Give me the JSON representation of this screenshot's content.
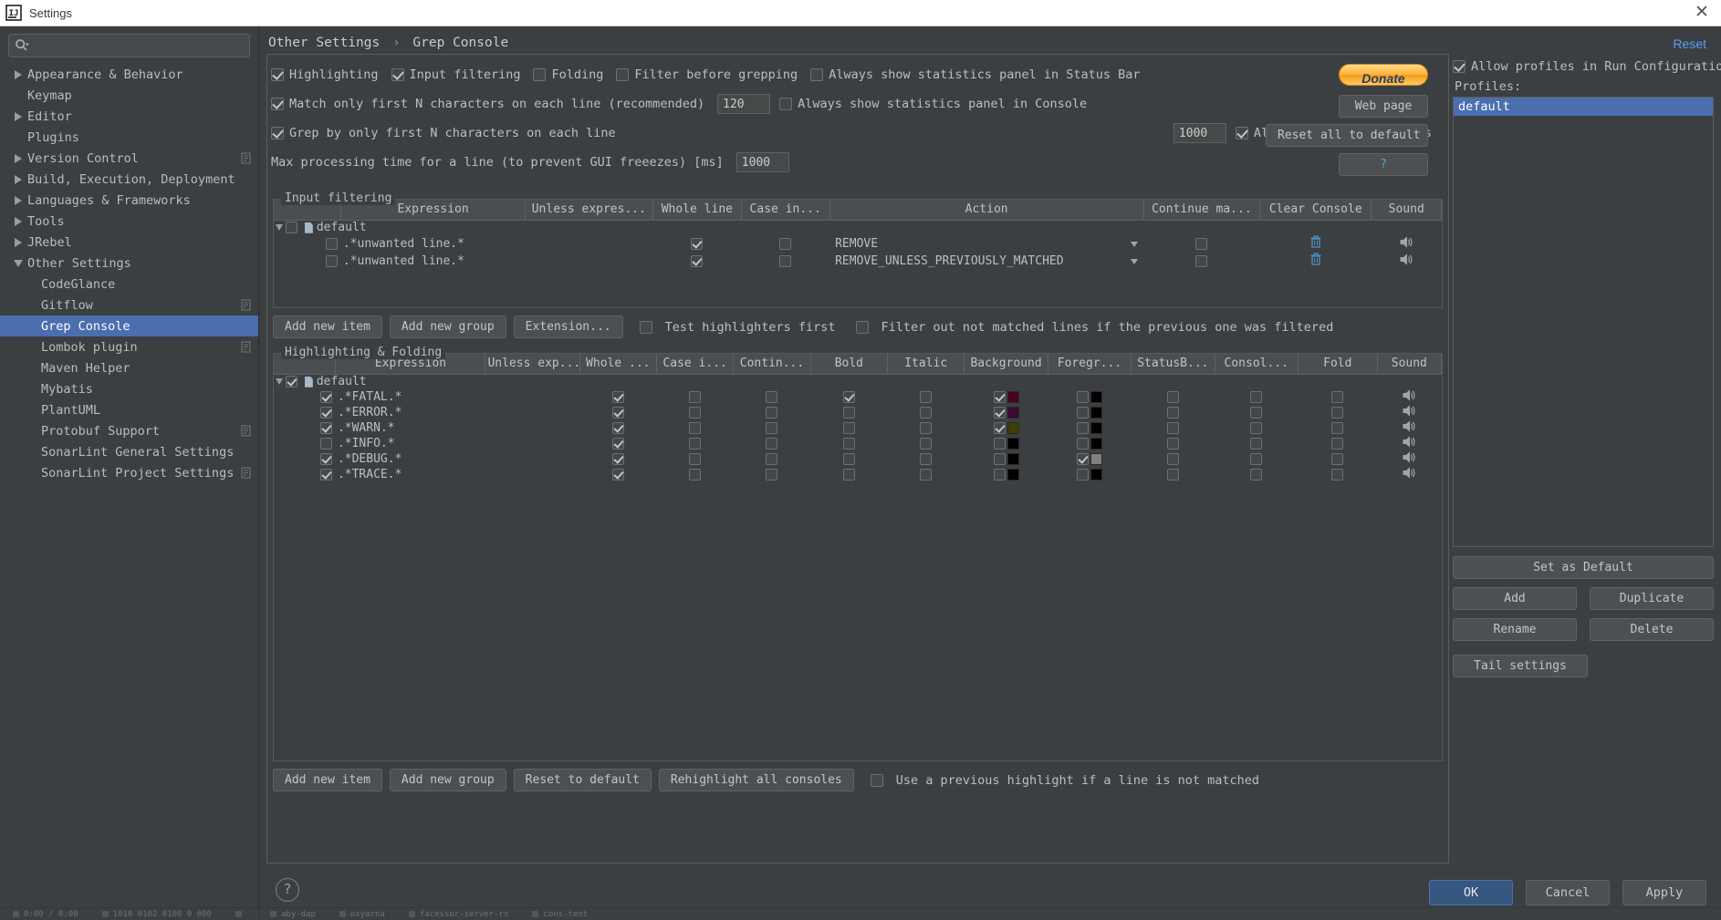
{
  "window": {
    "title": "Settings",
    "close_label": "✕",
    "logo": "intellij-idea-logo"
  },
  "sidebar": {
    "search_placeholder": "",
    "items": [
      {
        "label": "Appearance & Behavior",
        "level": 1,
        "twisty": "collapsed",
        "selected": false,
        "badge": false
      },
      {
        "label": "Keymap",
        "level": 1,
        "twisty": "none",
        "selected": false,
        "badge": false
      },
      {
        "label": "Editor",
        "level": 1,
        "twisty": "collapsed",
        "selected": false,
        "badge": false
      },
      {
        "label": "Plugins",
        "level": 1,
        "twisty": "none",
        "selected": false,
        "badge": false
      },
      {
        "label": "Version Control",
        "level": 1,
        "twisty": "collapsed",
        "selected": false,
        "badge": true
      },
      {
        "label": "Build, Execution, Deployment",
        "level": 1,
        "twisty": "collapsed",
        "selected": false,
        "badge": false
      },
      {
        "label": "Languages & Frameworks",
        "level": 1,
        "twisty": "collapsed",
        "selected": false,
        "badge": false
      },
      {
        "label": "Tools",
        "level": 1,
        "twisty": "collapsed",
        "selected": false,
        "badge": false
      },
      {
        "label": "JRebel",
        "level": 1,
        "twisty": "collapsed",
        "selected": false,
        "badge": false
      },
      {
        "label": "Other Settings",
        "level": 1,
        "twisty": "expanded",
        "selected": false,
        "badge": false
      },
      {
        "label": "CodeGlance",
        "level": 2,
        "twisty": "none",
        "selected": false,
        "badge": false
      },
      {
        "label": "Gitflow",
        "level": 2,
        "twisty": "none",
        "selected": false,
        "badge": true
      },
      {
        "label": "Grep Console",
        "level": 2,
        "twisty": "none",
        "selected": true,
        "badge": false
      },
      {
        "label": "Lombok plugin",
        "level": 2,
        "twisty": "none",
        "selected": false,
        "badge": true
      },
      {
        "label": "Maven Helper",
        "level": 2,
        "twisty": "none",
        "selected": false,
        "badge": false
      },
      {
        "label": "Mybatis",
        "level": 2,
        "twisty": "none",
        "selected": false,
        "badge": false
      },
      {
        "label": "PlantUML",
        "level": 2,
        "twisty": "none",
        "selected": false,
        "badge": false
      },
      {
        "label": "Protobuf Support",
        "level": 2,
        "twisty": "none",
        "selected": false,
        "badge": true
      },
      {
        "label": "SonarLint General Settings",
        "level": 2,
        "twisty": "none",
        "selected": false,
        "badge": false
      },
      {
        "label": "SonarLint Project Settings",
        "level": 2,
        "twisty": "none",
        "selected": false,
        "badge": true
      }
    ]
  },
  "header": {
    "breadcrumb_root": "Other Settings",
    "breadcrumb_sep": "›",
    "breadcrumb_leaf": "Grep Console",
    "reset_label": "Reset"
  },
  "options": {
    "row1": [
      {
        "label": "Highlighting",
        "checked": true
      },
      {
        "label": "Input filtering",
        "checked": true
      },
      {
        "label": "Folding",
        "checked": false
      },
      {
        "label": "Filter before grepping",
        "checked": false
      },
      {
        "label": "Always show statistics panel in Status Bar",
        "checked": false
      }
    ],
    "row2": {
      "label": "Match only first N characters on each line (recommended)",
      "checked": true,
      "value": "120",
      "right_label": "Always show statistics panel in Console",
      "right_checked": false
    },
    "row3": {
      "label": "Grep by only first N characters on each line",
      "checked": true,
      "value": "1000",
      "right_label": "Always pin grep consoles",
      "right_checked": true
    },
    "row4": {
      "label": "Max processing time for a line (to prevent GUI freeezes) [ms]",
      "value": "1000"
    },
    "buttons": {
      "donate": "Donate",
      "web_page": "Web page",
      "reset_all": "Reset all to default",
      "help": "?"
    }
  },
  "input_filtering": {
    "legend": "Input filtering",
    "columns": [
      "",
      "Expression",
      "Unless expres...",
      "Whole line",
      "Case in...",
      "Action",
      "Continue ma...",
      "Clear Console",
      "Sound"
    ],
    "rows": [
      {
        "type": "group",
        "expression": "default",
        "checked": false,
        "twisty": "expanded"
      },
      {
        "type": "item",
        "expression": ".*unwanted line.*",
        "enabled": false,
        "unless": "",
        "whole_line": true,
        "case_insensitive": false,
        "action": "REMOVE",
        "continue_matching": false,
        "clear_console": "trash-icon",
        "sound": "speaker-icon"
      },
      {
        "type": "item",
        "expression": ".*unwanted line.*",
        "enabled": false,
        "unless": "",
        "whole_line": true,
        "case_insensitive": false,
        "action": "REMOVE_UNLESS_PREVIOUSLY_MATCHED",
        "continue_matching": false,
        "clear_console": "trash-icon",
        "sound": "speaker-icon"
      }
    ],
    "toolbar": {
      "add_new_item": "Add new item",
      "add_new_group": "Add new group",
      "extension": "Extension...",
      "test_highlighters_label": "Test highlighters first",
      "test_highlighters_checked": false,
      "filter_out_label": "Filter out not matched lines if the previous one was filtered",
      "filter_out_checked": false
    }
  },
  "highlighting": {
    "legend": "Highlighting & Folding",
    "columns": [
      "",
      "Expression",
      "Unless exp...",
      "Whole ...",
      "Case i...",
      "Contin...",
      "Bold",
      "Italic",
      "Background",
      "Foregr...",
      "StatusB...",
      "Consol...",
      "Fold",
      "Sound"
    ],
    "rows": [
      {
        "type": "group",
        "expression": "default",
        "checked": true,
        "twisty": "expanded"
      },
      {
        "type": "item",
        "expression": ".*FATAL.*",
        "enabled": true,
        "whole": true,
        "case": false,
        "contin": false,
        "bold": true,
        "italic": false,
        "background_checked": true,
        "background_color": "#4a0022",
        "foreground_checked": false,
        "foreground_color": "#000000",
        "statusbar": false,
        "console": false,
        "fold": false,
        "sound": "speaker-icon"
      },
      {
        "type": "item",
        "expression": ".*ERROR.*",
        "enabled": true,
        "whole": true,
        "case": false,
        "contin": false,
        "bold": false,
        "italic": false,
        "background_checked": true,
        "background_color": "#3d0a33",
        "foreground_checked": false,
        "foreground_color": "#000000",
        "statusbar": false,
        "console": false,
        "fold": false,
        "sound": "speaker-icon"
      },
      {
        "type": "item",
        "expression": ".*WARN.*",
        "enabled": true,
        "whole": true,
        "case": false,
        "contin": false,
        "bold": false,
        "italic": false,
        "background_checked": true,
        "background_color": "#3e3e08",
        "foreground_checked": false,
        "foreground_color": "#000000",
        "statusbar": false,
        "console": false,
        "fold": false,
        "sound": "speaker-icon"
      },
      {
        "type": "item",
        "expression": ".*INFO.*",
        "enabled": false,
        "whole": true,
        "case": false,
        "contin": false,
        "bold": false,
        "italic": false,
        "background_checked": false,
        "background_color": "#000000",
        "foreground_checked": false,
        "foreground_color": "#000000",
        "statusbar": false,
        "console": false,
        "fold": false,
        "sound": "speaker-icon"
      },
      {
        "type": "item",
        "expression": ".*DEBUG.*",
        "enabled": true,
        "whole": true,
        "case": false,
        "contin": false,
        "bold": false,
        "italic": false,
        "background_checked": false,
        "background_color": "#000000",
        "foreground_checked": true,
        "foreground_color": "#808080",
        "statusbar": false,
        "console": false,
        "fold": false,
        "sound": "speaker-icon"
      },
      {
        "type": "item",
        "expression": ".*TRACE.*",
        "enabled": true,
        "whole": true,
        "case": false,
        "contin": false,
        "bold": false,
        "italic": false,
        "background_checked": false,
        "background_color": "#000000",
        "foreground_checked": false,
        "foreground_color": "#000000",
        "statusbar": false,
        "console": false,
        "fold": false,
        "sound": "speaker-icon"
      }
    ],
    "toolbar": {
      "add_new_item": "Add new item",
      "add_new_group": "Add new group",
      "reset_to_default": "Reset to default",
      "rehighlight": "Rehighlight all consoles",
      "use_previous_label": "Use a previous highlight if a line is not matched",
      "use_previous_checked": false
    }
  },
  "profiles": {
    "allow_label": "Allow profiles in Run Configuration:",
    "allow_checked": true,
    "profiles_label": "Profiles:",
    "items": [
      "default"
    ],
    "set_as_default": "Set as Default",
    "add": "Add",
    "duplicate": "Duplicate",
    "rename": "Rename",
    "delete": "Delete",
    "tail_settings": "Tail settings"
  },
  "dialog_buttons": {
    "ok": "OK",
    "cancel": "Cancel",
    "apply": "Apply",
    "help": "?"
  }
}
